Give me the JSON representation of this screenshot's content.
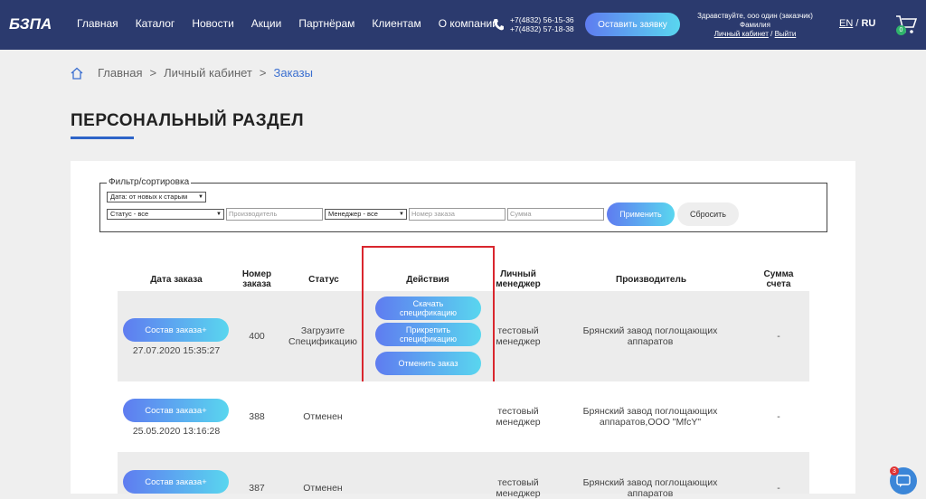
{
  "header": {
    "logo_text": "БЗПА",
    "nav": [
      "Главная",
      "Каталог",
      "Новости",
      "Акции",
      "Партнёрам",
      "Клиентам",
      "О компании"
    ],
    "phones": [
      "+7(4832) 56-15-36",
      "+7(4832) 57-18-38"
    ],
    "cta_label": "Оставить заявку",
    "user_greeting": "Здравствуйте, ооо один (заказчик)",
    "user_surname": "Фамилия",
    "cabinet_link": "Личный кабинет",
    "slash": "/",
    "logout_link": "Выйти",
    "lang_en": "EN",
    "lang_sep": "/",
    "lang_ru": "RU",
    "cart_count": "0"
  },
  "breadcrumb": {
    "home": "Главная",
    "sep1": ">",
    "cabinet": "Личный кабинет",
    "sep2": ">",
    "current": "Заказы"
  },
  "page_title": "ПЕРСОНАЛЬНЫЙ РАЗДЕЛ",
  "filter": {
    "legend": "Фильтр/сортировка",
    "sort_value": "Дата: от новых к старым",
    "status_value": "Статус - все",
    "producer_placeholder": "Производитель",
    "manager_value": "Менеджер - все",
    "order_number_placeholder": "Номер заказа",
    "sum_placeholder": "Сумма",
    "apply_label": "Применить",
    "reset_label": "Сбросить"
  },
  "table": {
    "headers": {
      "date": "Дата заказа",
      "number_1": "Номер",
      "number_2": "заказа",
      "status": "Статус",
      "actions": "Действия",
      "manager_1": "Личный",
      "manager_2": "менеджер",
      "producer": "Производитель",
      "sum_1": "Сумма",
      "sum_2": "счета"
    },
    "order_btn_label": "Состав заказа+",
    "actions": {
      "download_1": "Скачать",
      "download_2": "спецификацию",
      "attach_1": "Прикрепить",
      "attach_2": "спецификацию",
      "cancel": "Отменить заказ"
    },
    "rows": [
      {
        "date": "27.07.2020 15:35:27",
        "number": "400",
        "status_1": "Загрузите",
        "status_2": "Спецификацию",
        "manager_1": "тестовый",
        "manager_2": "менеджер",
        "producer_1": "Брянский завод поглощающих",
        "producer_2": "аппаратов",
        "sum": "-"
      },
      {
        "date": "25.05.2020 13:16:28",
        "number": "388",
        "status_1": "Отменен",
        "manager_1": "тестовый",
        "manager_2": "менеджер",
        "producer_1": "Брянский завод поглощающих",
        "producer_2": "аппаратов,ООО \"MfcY\"",
        "sum": "-"
      },
      {
        "number": "387",
        "status_1": "Отменен",
        "manager_1": "тестовый",
        "manager_2": "менеджер",
        "producer_1": "Брянский завод поглощающих",
        "producer_2": "аппаратов",
        "sum": "-"
      }
    ]
  },
  "chat_badge": "3"
}
